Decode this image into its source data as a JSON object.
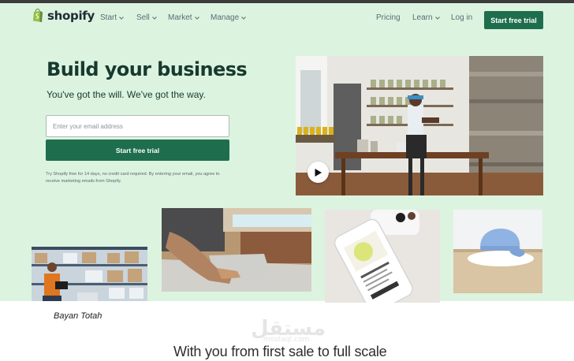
{
  "nav": {
    "brand": "shopify",
    "start": "Start",
    "sell": "Sell",
    "market": "Market",
    "manage": "Manage",
    "pricing": "Pricing",
    "learn": "Learn",
    "login": "Log in",
    "cta": "Start free trial"
  },
  "hero": {
    "headline": "Build your business",
    "subline": "You've got the will. We've got the way.",
    "email_placeholder": "Enter your email address",
    "cta": "Start free trial",
    "disclaimer": "Try Shopify free for 14 days, no credit card required. By entering your email, you agree to receive marketing emails from Shopify."
  },
  "caption": "Bayan Totah",
  "watermark": {
    "arabic": "مستقل",
    "latin": "mostaql.com"
  },
  "tagline": "With you from first sale to full scale",
  "colors": {
    "hero_bg": "#dcf3e0",
    "brand_green": "#1e6e4e",
    "headline": "#173a2f",
    "logo_green": "#95bf47"
  }
}
